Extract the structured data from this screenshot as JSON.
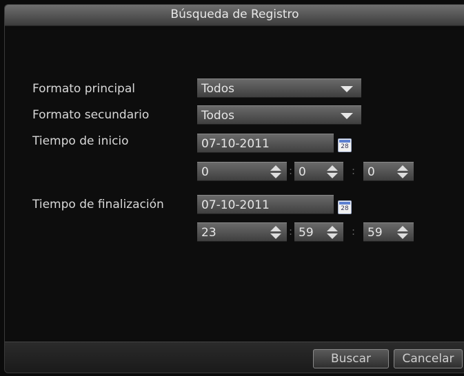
{
  "dialog": {
    "title": "Búsqueda de Registro"
  },
  "form": {
    "main_format_label": "Formato principal",
    "main_format_value": "Todos",
    "secondary_format_label": "Formato secundario",
    "secondary_format_value": "Todos",
    "start_label": "Tiempo de inicio",
    "start_date": "07-10-2011",
    "start_hour": "0",
    "start_minute": "0",
    "start_second": "0",
    "end_label": "Tiempo de finalización",
    "end_date": "07-10-2011",
    "end_hour": "23",
    "end_minute": "59",
    "end_second": "59",
    "time_separator": ":"
  },
  "footer": {
    "search_label": "Buscar",
    "cancel_label": "Cancelar"
  },
  "icons": {
    "calendar_text": "28",
    "dropdown": "chevron-down-icon",
    "spinner": "spinner-icon",
    "calendar": "calendar-icon"
  }
}
